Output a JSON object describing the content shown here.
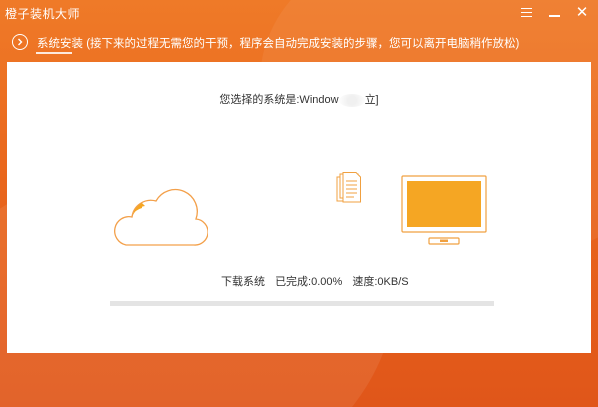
{
  "app": {
    "title": "橙子装机大师"
  },
  "window_controls": {
    "menu_icon": "menu-icon",
    "minimize_icon": "minimize-icon",
    "close_icon": "close-icon",
    "close_glyph": "✕"
  },
  "step": {
    "icon": "chevron-right-circle-icon",
    "text": "系统安装 (接下来的过程无需您的干预，程序会自动完成安装的步骤，您可以离开电脑稍作放松)"
  },
  "main": {
    "chosen_system_prefix": "您选择的系统是:Window",
    "chosen_system_suffix": "立]",
    "status": {
      "task": "下载系统",
      "completed": "已完成:0.00%",
      "speed": "速度:0KB/S"
    },
    "progress_fraction": 0.0,
    "illustrations": [
      "cloud-icon",
      "document-icon",
      "monitor-icon"
    ]
  },
  "colors": {
    "accent": "#f08a2c",
    "brand": "#e9661c",
    "monitor_screen": "#f5a623"
  }
}
